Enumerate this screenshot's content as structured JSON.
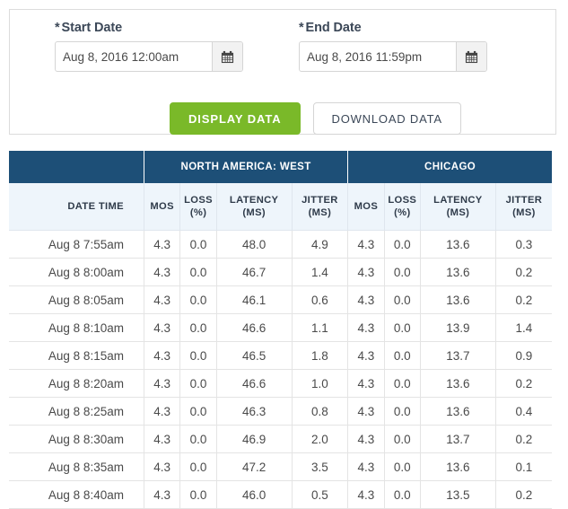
{
  "form": {
    "start": {
      "label": "Start Date",
      "required_marker": "*",
      "value": "Aug 8, 2016 12:00am",
      "placeholder": "Aug 8, 2016 12:00am",
      "calendar_icon": "calendar-icon"
    },
    "end": {
      "label": "End Date",
      "required_marker": "*",
      "value": "Aug 8, 2016 11:59pm",
      "placeholder": "Aug 8, 2016 11:59pm",
      "calendar_icon": "calendar-icon"
    },
    "display_button": "DISPLAY DATA",
    "download_button": "DOWNLOAD DATA"
  },
  "colors": {
    "header_blue": "#1d4f77",
    "subheader_blue": "#eef5fb",
    "primary_green": "#7ab929",
    "panel_border": "#dcdcdc",
    "text": "#3c4858"
  },
  "table": {
    "groups": [
      {
        "label": "",
        "span": 1
      },
      {
        "label": "NORTH AMERICA: WEST",
        "span": 4
      },
      {
        "label": "CHICAGO",
        "span": 4
      }
    ],
    "columns": [
      "DATE TIME",
      "MOS",
      "LOSS\n(%)",
      "LATENCY\n(MS)",
      "JITTER\n(MS)",
      "MOS",
      "LOSS\n(%)",
      "LATENCY\n(MS)",
      "JITTER\n(MS)"
    ],
    "columns_split": [
      {
        "line1": "DATE TIME",
        "line2": ""
      },
      {
        "line1": "MOS",
        "line2": ""
      },
      {
        "line1": "LOSS",
        "line2": "(%)"
      },
      {
        "line1": "LATENCY",
        "line2": "(MS)"
      },
      {
        "line1": "JITTER",
        "line2": "(MS)"
      },
      {
        "line1": "MOS",
        "line2": ""
      },
      {
        "line1": "LOSS",
        "line2": "(%)"
      },
      {
        "line1": "LATENCY",
        "line2": "(MS)"
      },
      {
        "line1": "JITTER",
        "line2": "(MS)"
      }
    ],
    "rows": [
      [
        "Aug 8  7:55am",
        "4.3",
        "0.0",
        "48.0",
        "4.9",
        "4.3",
        "0.0",
        "13.6",
        "0.3"
      ],
      [
        "Aug 8  8:00am",
        "4.3",
        "0.0",
        "46.7",
        "1.4",
        "4.3",
        "0.0",
        "13.6",
        "0.2"
      ],
      [
        "Aug 8  8:05am",
        "4.3",
        "0.0",
        "46.1",
        "0.6",
        "4.3",
        "0.0",
        "13.6",
        "0.2"
      ],
      [
        "Aug 8  8:10am",
        "4.3",
        "0.0",
        "46.6",
        "1.1",
        "4.3",
        "0.0",
        "13.9",
        "1.4"
      ],
      [
        "Aug 8  8:15am",
        "4.3",
        "0.0",
        "46.5",
        "1.8",
        "4.3",
        "0.0",
        "13.7",
        "0.9"
      ],
      [
        "Aug 8  8:20am",
        "4.3",
        "0.0",
        "46.6",
        "1.0",
        "4.3",
        "0.0",
        "13.6",
        "0.2"
      ],
      [
        "Aug 8  8:25am",
        "4.3",
        "0.0",
        "46.3",
        "0.8",
        "4.3",
        "0.0",
        "13.6",
        "0.4"
      ],
      [
        "Aug 8  8:30am",
        "4.3",
        "0.0",
        "46.9",
        "2.0",
        "4.3",
        "0.0",
        "13.7",
        "0.2"
      ],
      [
        "Aug 8  8:35am",
        "4.3",
        "0.0",
        "47.2",
        "3.5",
        "4.3",
        "0.0",
        "13.6",
        "0.1"
      ],
      [
        "Aug 8  8:40am",
        "4.3",
        "0.0",
        "46.0",
        "0.5",
        "4.3",
        "0.0",
        "13.5",
        "0.2"
      ]
    ]
  }
}
